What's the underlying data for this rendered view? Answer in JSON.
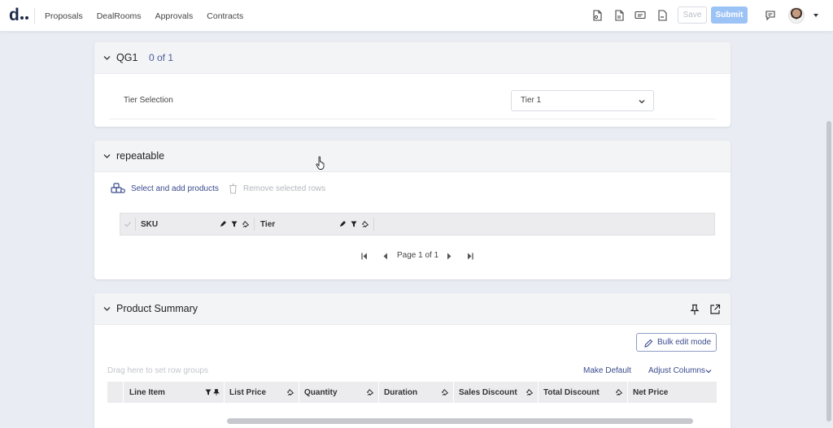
{
  "nav": {
    "logo": "d",
    "items": [
      "Proposals",
      "DealRooms",
      "Approvals",
      "Contracts"
    ],
    "save_label": "Save",
    "submit_label": "Submit"
  },
  "qg1": {
    "title": "QG1",
    "count": "0 of 1",
    "field_label": "Tier Selection",
    "select_value": "Tier 1"
  },
  "repeatable": {
    "title": "repeatable",
    "add_label": "Select and add products",
    "remove_label": "Remove selected rows",
    "columns": [
      "SKU",
      "Tier"
    ],
    "page_text": "Page 1 of 1"
  },
  "summary": {
    "title": "Product Summary",
    "bulk_label": "Bulk edit mode",
    "drag_hint": "Drag here to set row groups",
    "make_default": "Make Default",
    "adjust_columns": "Adjust Columns",
    "columns": [
      "Line Item",
      "List Price",
      "Quantity",
      "Duration",
      "Sales Discount",
      "Total Discount",
      "Net Price"
    ]
  },
  "colors": {
    "accent": "#3a4a8c",
    "submit": "#9cc3f5",
    "background": "#e9ecf3"
  }
}
